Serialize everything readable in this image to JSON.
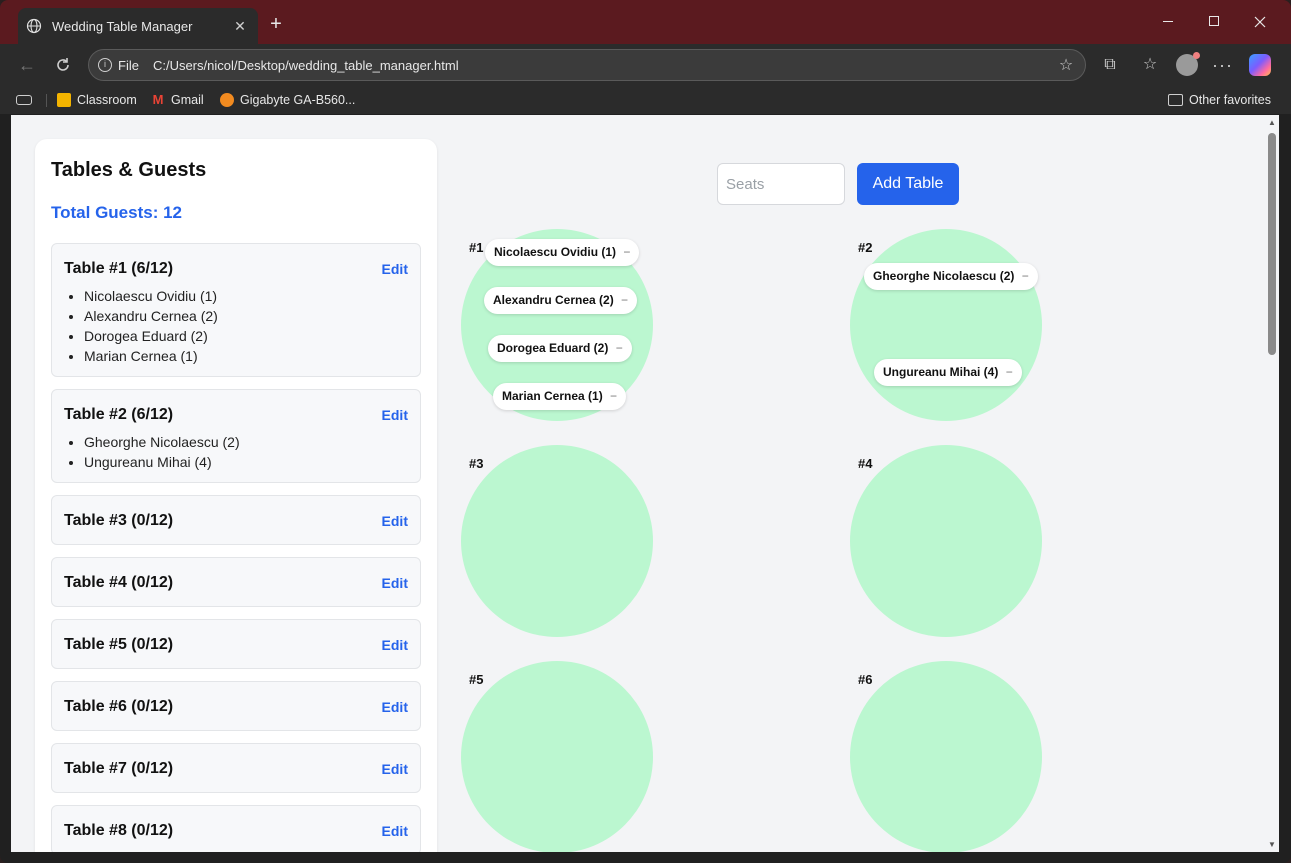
{
  "browser": {
    "tab_title": "Wedding Table Manager",
    "tab_close": "✕",
    "new_tab": "+",
    "address_scheme": "File",
    "address_url": "C:/Users/nicol/Desktop/wedding_table_manager.html",
    "bookmarks": [
      {
        "label": "Classroom"
      },
      {
        "label": "Gmail"
      },
      {
        "label": "Gigabyte GA-B560..."
      }
    ],
    "other_favorites": "Other favorites"
  },
  "sidebar": {
    "title": "Tables & Guests",
    "total_guests": "Total Guests: 12",
    "edit_label": "Edit",
    "tables": [
      {
        "title": "Table #1 (6/12)",
        "guests": [
          "Nicolaescu Ovidiu (1)",
          "Alexandru Cernea (2)",
          "Dorogea Eduard (2)",
          "Marian Cernea (1)"
        ]
      },
      {
        "title": "Table #2 (6/12)",
        "guests": [
          "Gheorghe Nicolaescu (2)",
          "Ungureanu Mihai (4)"
        ]
      },
      {
        "title": "Table #3 (0/12)",
        "guests": []
      },
      {
        "title": "Table #4 (0/12)",
        "guests": []
      },
      {
        "title": "Table #5 (0/12)",
        "guests": []
      },
      {
        "title": "Table #6 (0/12)",
        "guests": []
      },
      {
        "title": "Table #7 (0/12)",
        "guests": []
      },
      {
        "title": "Table #8 (0/12)",
        "guests": []
      }
    ]
  },
  "controls": {
    "seats_placeholder": "Seats",
    "add_table_label": "Add Table"
  },
  "floor": {
    "remove_symbol": "−",
    "tables": [
      {
        "label": "#1",
        "chips": [
          "Nicolaescu Ovidiu (1)",
          "Alexandru Cernea (2)",
          "Dorogea Eduard (2)",
          "Marian Cernea (1)"
        ]
      },
      {
        "label": "#2",
        "chips": [
          "Gheorghe Nicolaescu (2)",
          "Ungureanu Mihai (4)"
        ]
      },
      {
        "label": "#3",
        "chips": []
      },
      {
        "label": "#4",
        "chips": []
      },
      {
        "label": "#5",
        "chips": []
      },
      {
        "label": "#6",
        "chips": []
      }
    ]
  },
  "colors": {
    "accent": "#2563eb",
    "table_fill": "#bbf7d0",
    "titlebar": "#5b1a1f"
  }
}
